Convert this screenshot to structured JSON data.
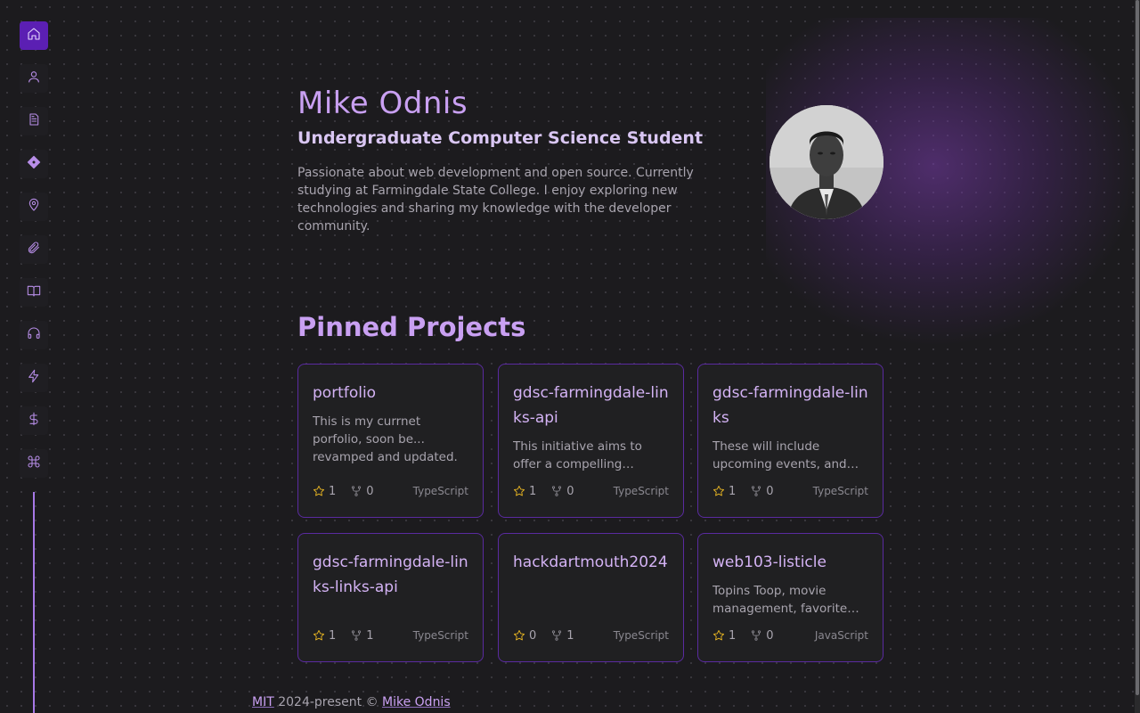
{
  "theme": {
    "accent": "#5b1fb3",
    "title_color": "#c9a0f2",
    "card_border": "#5a2aa0",
    "star_color": "#e6b422"
  },
  "sidebar": {
    "items": [
      {
        "icon": "home-icon",
        "active": true
      },
      {
        "icon": "user-icon"
      },
      {
        "icon": "document-icon"
      },
      {
        "icon": "diamond-icon"
      },
      {
        "icon": "map-pin-icon"
      },
      {
        "icon": "paperclip-icon"
      },
      {
        "icon": "book-open-icon"
      },
      {
        "icon": "headphones-icon"
      },
      {
        "icon": "lightning-icon"
      },
      {
        "icon": "dollar-icon"
      },
      {
        "icon": "command-icon"
      }
    ]
  },
  "hero": {
    "name": "Mike Odnis",
    "subtitle": "Undergraduate Computer Science Student",
    "bio": "Passionate about web development and open source. Currently studying at Farmingdale State College. I enjoy exploring new technologies and sharing my knowledge with the developer community."
  },
  "projects": {
    "title": "Pinned Projects",
    "cards": [
      {
        "name": "portfolio",
        "description": "This is my currnet porfolio, soon be... revamped and updated.",
        "stars": "1",
        "forks": "0",
        "language": "TypeScript"
      },
      {
        "name": "gdsc-farmingdale-links-api",
        "description": "This initiative aims to offer a compelling platform for students...",
        "stars": "1",
        "forks": "0",
        "language": "TypeScript"
      },
      {
        "name": "gdsc-farmingdale-links",
        "description": "These will include upcoming events, and resources for members...",
        "stars": "1",
        "forks": "0",
        "language": "TypeScript"
      },
      {
        "name": "gdsc-farmingdale-links-links-api",
        "description": "",
        "stars": "1",
        "forks": "1",
        "language": "TypeScript"
      },
      {
        "name": "hackdartmouth2024",
        "description": "",
        "stars": "0",
        "forks": "1",
        "language": "TypeScript"
      },
      {
        "name": "web103-listicle",
        "description": "Topins Toop, movie management, favorite movies list...",
        "stars": "1",
        "forks": "0",
        "language": "JavaScript"
      }
    ]
  },
  "footer": {
    "license": "MIT",
    "years": " 2024-present © ",
    "author": "Mike Odnis"
  }
}
